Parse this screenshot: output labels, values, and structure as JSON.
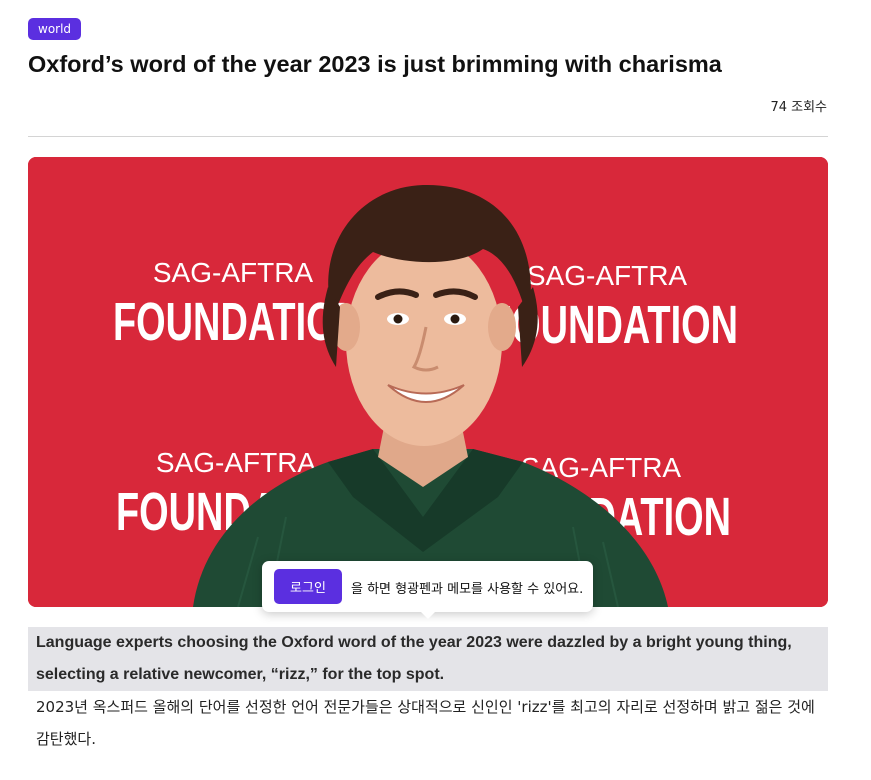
{
  "article": {
    "category": "world",
    "title": "Oxford’s word of the year 2023 is just brimming with charisma",
    "views": "74 조회수"
  },
  "image": {
    "backdrop_color": "#d8283a",
    "backdrop_text_small": "SAG-AFTRA",
    "backdrop_text_large": "FOUNDATION"
  },
  "login_prompt": {
    "button_label": "로그인",
    "message": "을 하면 형광펜과 메모를 사용할 수 있어요."
  },
  "body": {
    "english": "Language experts choosing the Oxford word of the year 2023 were dazzled by a bright young thing, selecting a relative newcomer, “rizz,” for the top spot.",
    "korean": "2023년 옥스퍼드 올해의 단어를 선정한 언어 전문가들은 상대적으로 신인인 'rizz'를 최고의 자리로 선정하며 밝고 젊은 것에 감탄했다."
  },
  "colors": {
    "accent": "#5b2fe0",
    "highlight_bg": "#e4e4e8"
  }
}
